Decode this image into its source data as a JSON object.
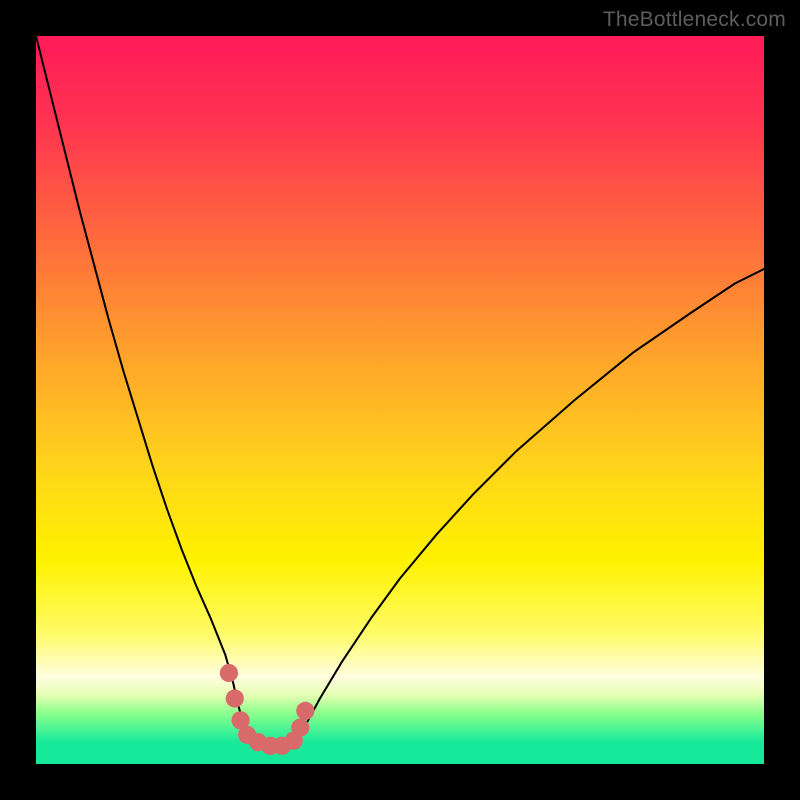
{
  "attribution": "TheBottleneck.com",
  "colors": {
    "frame": "#000000",
    "attribution_text": "#5d5d5d",
    "curve_main": "#000000",
    "marker_fill": "#d96a6a",
    "gradient_stops": [
      {
        "offset": 0.0,
        "color": "#ff1a58"
      },
      {
        "offset": 0.12,
        "color": "#ff3450"
      },
      {
        "offset": 0.28,
        "color": "#ff6b3d"
      },
      {
        "offset": 0.45,
        "color": "#ffa72a"
      },
      {
        "offset": 0.6,
        "color": "#ffd61a"
      },
      {
        "offset": 0.72,
        "color": "#fff200"
      },
      {
        "offset": 0.82,
        "color": "#fffb66"
      },
      {
        "offset": 0.88,
        "color": "#fffde0"
      },
      {
        "offset": 0.905,
        "color": "#e6ffb3"
      },
      {
        "offset": 0.93,
        "color": "#8cff8c"
      },
      {
        "offset": 0.97,
        "color": "#18ea9a"
      },
      {
        "offset": 1.0,
        "color": "#15e89a"
      }
    ]
  },
  "chart_data": {
    "type": "line",
    "title": "",
    "xlabel": "",
    "ylabel": "",
    "xlim": [
      0,
      100
    ],
    "ylim": [
      0,
      100
    ],
    "grid": false,
    "series": [
      {
        "name": "bottleneck-curve",
        "x": [
          0.0,
          2.0,
          4.0,
          6.0,
          8.0,
          10.0,
          12.0,
          14.0,
          16.0,
          18.0,
          20.0,
          22.0,
          24.0,
          26.0,
          27.0,
          27.8,
          28.5,
          30.0,
          32.0,
          34.0,
          35.0,
          36.0,
          37.0,
          39.0,
          42.0,
          46.0,
          50.0,
          55.0,
          60.0,
          66.0,
          74.0,
          82.0,
          90.0,
          96.0,
          100.0
        ],
        "y": [
          100.0,
          92.0,
          84.0,
          76.0,
          68.5,
          61.0,
          54.0,
          47.5,
          41.0,
          35.0,
          29.5,
          24.5,
          20.0,
          15.0,
          11.5,
          8.0,
          5.5,
          3.3,
          2.3,
          2.3,
          2.3,
          3.3,
          5.3,
          9.0,
          14.0,
          20.0,
          25.5,
          31.5,
          37.0,
          43.0,
          50.0,
          56.5,
          62.0,
          66.0,
          68.0
        ]
      }
    ],
    "markers": {
      "name": "highlighted-points",
      "x": [
        26.5,
        27.3,
        28.1,
        29.0,
        30.5,
        32.2,
        33.8,
        35.4,
        36.3,
        37.0
      ],
      "y": [
        12.5,
        9.0,
        6.0,
        4.0,
        3.0,
        2.5,
        2.5,
        3.2,
        5.0,
        7.3
      ]
    }
  }
}
